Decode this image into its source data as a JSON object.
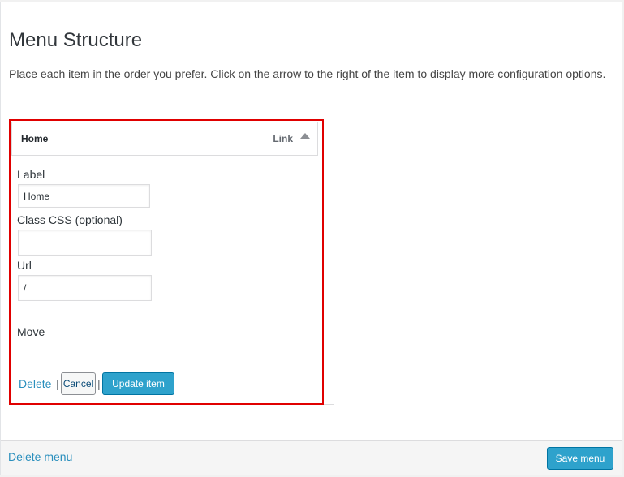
{
  "page": {
    "title": "Menu Structure",
    "intro": "Place each item in the order you prefer. Click on the arrow to the right of the item to display more configuration options."
  },
  "menu_item": {
    "title": "Home",
    "type": "Link",
    "label_field": {
      "label": "Label",
      "value": "Home"
    },
    "css_field": {
      "label": "Class CSS (optional)",
      "value": ""
    },
    "url_field": {
      "label": "Url",
      "value": "/"
    },
    "move_label": "Move",
    "delete_label": "Delete",
    "separator": "|",
    "cancel_label": "Cancel",
    "update_label": "Update item"
  },
  "footer": {
    "delete_menu_label": "Delete menu",
    "save_menu_label": "Save menu"
  },
  "colors": {
    "accent": "#2ea2cc",
    "highlight": "#e00000",
    "link": "#2a8fbd"
  }
}
